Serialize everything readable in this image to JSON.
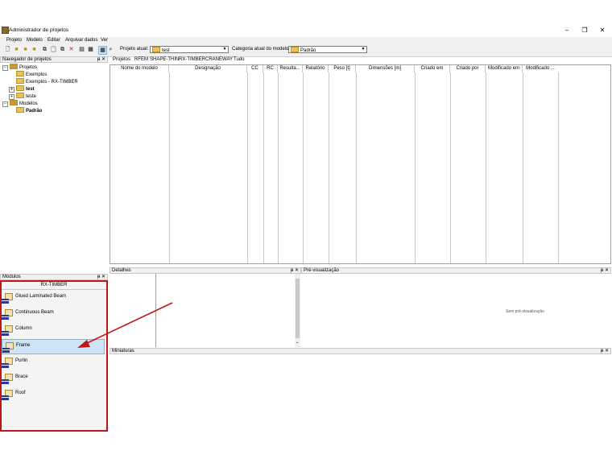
{
  "window": {
    "title": "Administrador de projetos",
    "controls": {
      "minimize": "–",
      "restore": "❐",
      "close": "✕"
    }
  },
  "menu": [
    "Projeto",
    "Modelo",
    "Editar",
    "Arquivar dados",
    "Ver"
  ],
  "toolbar": {
    "current_project_label": "Projeto atual:",
    "current_project_value": "test",
    "model_category_label": "Categoria atual do modelo",
    "model_category_value": "Padrão"
  },
  "navigator": {
    "title": "Navegador de projetos",
    "tree": {
      "projects": "Projetos",
      "examples": "Exemplos",
      "examples_rx": "Exemplos - RX-TIMBER",
      "test_bold": "test",
      "teste": "teste",
      "models": "Modelos",
      "default": "Padrão"
    }
  },
  "tabs": [
    "Projetos",
    "RFEM",
    "SHAPE-THIN",
    "RX-TIMBER",
    "CRANEWAY",
    "Tudo"
  ],
  "table": {
    "columns": [
      "Nome do modelo",
      "Designação",
      "CC",
      "RC",
      "Resulta...",
      "Relatório",
      "Peso [t]",
      "Dimensões [m]",
      "Criado em",
      "Criado por",
      "Modificado em",
      "Modificado ..."
    ]
  },
  "details": {
    "title": "Detalhes"
  },
  "preview": {
    "title": "Pré-visualização",
    "empty_text": "Sem pré-visualização"
  },
  "thumbnails": {
    "title": "Miniaturas"
  },
  "modules": {
    "title": "Módulos",
    "group": "RX-TIMBER",
    "items": [
      "Glued Laminated Beam",
      "Continuous Beam",
      "Column",
      "Frame",
      "Purlin",
      "Brace",
      "Roof"
    ],
    "selected_index": 3
  },
  "panel_buttons": {
    "pin": "ᵽ",
    "close": "✕"
  },
  "colors": {
    "highlight_red": "#c0161a",
    "selection_blue": "#cde4f7"
  }
}
